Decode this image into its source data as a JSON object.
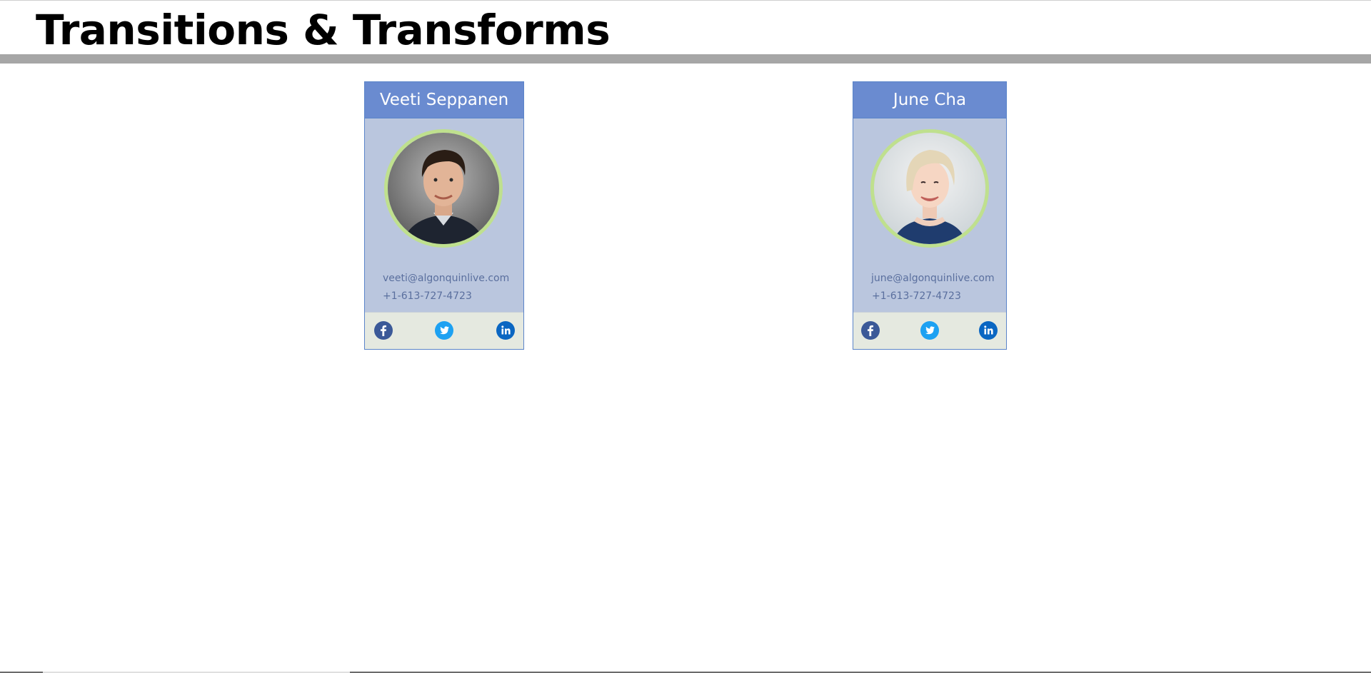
{
  "page": {
    "title": "Transitions & Transforms"
  },
  "cards": [
    {
      "name": "Veeti Seppanen",
      "email": "veeti@algonquinlive.com",
      "phone": "+1-613-727-4723",
      "social": [
        "facebook-icon",
        "twitter-icon",
        "linkedin-icon"
      ]
    },
    {
      "name": "June Cha",
      "email": "june@algonquinlive.com",
      "phone": "+1-613-727-4723",
      "social": [
        "facebook-icon",
        "twitter-icon",
        "linkedin-icon"
      ]
    }
  ],
  "colors": {
    "card_header": "#6a8bd0",
    "card_body": "#bac6de",
    "card_footer": "#e5e9e0",
    "avatar_ring": "#bfe08e",
    "facebook": "#3b5998",
    "twitter": "#1da1f2",
    "linkedin": "#0a66c2",
    "title_rule": "#a6a6a6"
  }
}
